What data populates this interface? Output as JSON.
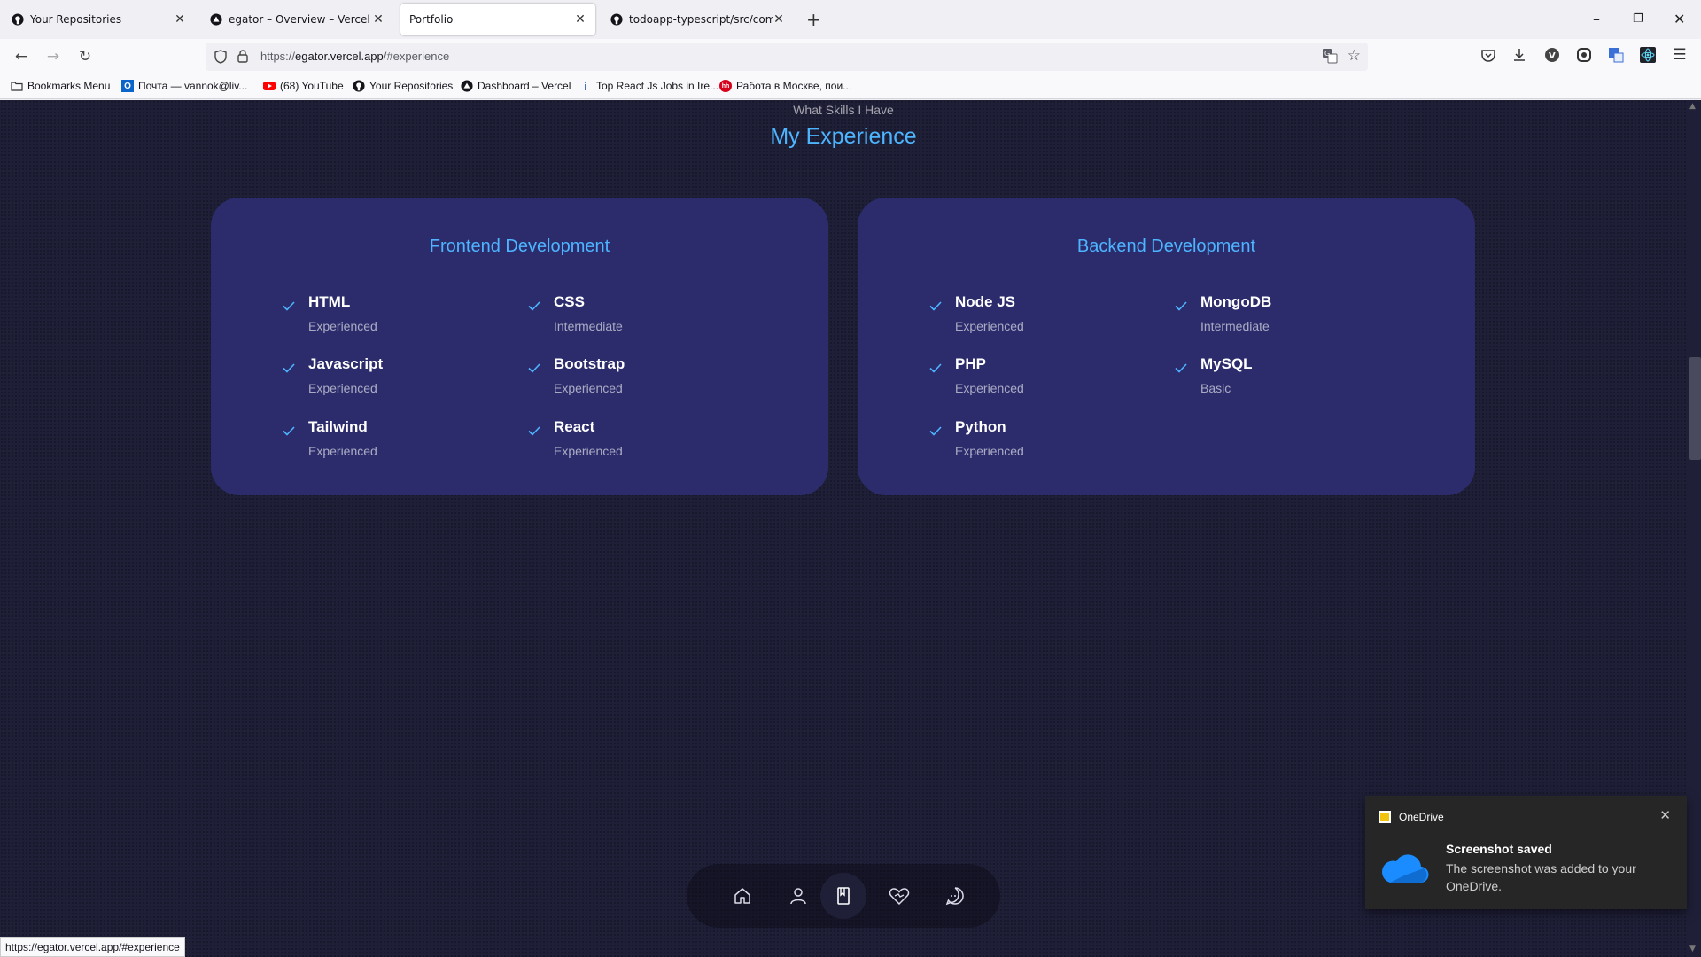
{
  "browser": {
    "tabs": [
      {
        "title": "Your Repositories",
        "icon": "github-icon",
        "active": false
      },
      {
        "title": "egator – Overview – Vercel",
        "icon": "vercel-icon",
        "active": false
      },
      {
        "title": "Portfolio",
        "icon": "",
        "active": true
      },
      {
        "title": "todoapp-typescript/src/compo",
        "icon": "github-icon",
        "active": false
      }
    ],
    "url_prefix": "https://",
    "url_domain": "egator.vercel.app",
    "url_path": "/#experience",
    "bookmarks": [
      {
        "label": "Bookmarks Menu",
        "icon": "folder-icon"
      },
      {
        "label": "Почта — vannok@liv...",
        "icon": "outlook-icon"
      },
      {
        "label": "(68) YouTube",
        "icon": "youtube-icon"
      },
      {
        "label": "Your Repositories",
        "icon": "github-icon"
      },
      {
        "label": "Dashboard – Vercel",
        "icon": "vercel-icon"
      },
      {
        "label": "Top React Js Jobs in Ire...",
        "icon": "indeed-icon"
      },
      {
        "label": "Работа в Москве, пои...",
        "icon": "hh-icon"
      }
    ]
  },
  "page": {
    "subtitle": "What Skills I Have",
    "heading": "My Experience",
    "accent_color": "#4db5ff",
    "card_color": "#2c2c6c",
    "background_color": "#1f1f38",
    "cards": [
      {
        "title": "Frontend Development",
        "skills": [
          {
            "name": "HTML",
            "level": "Experienced"
          },
          {
            "name": "CSS",
            "level": "Intermediate"
          },
          {
            "name": "Javascript",
            "level": "Experienced"
          },
          {
            "name": "Bootstrap",
            "level": "Experienced"
          },
          {
            "name": "Tailwind",
            "level": "Experienced"
          },
          {
            "name": "React",
            "level": "Experienced"
          }
        ]
      },
      {
        "title": "Backend Development",
        "skills": [
          {
            "name": "Node JS",
            "level": "Experienced"
          },
          {
            "name": "MongoDB",
            "level": "Intermediate"
          },
          {
            "name": "PHP",
            "level": "Experienced"
          },
          {
            "name": "MySQL",
            "level": "Basic"
          },
          {
            "name": "Python",
            "level": "Experienced"
          }
        ]
      }
    ],
    "dock": [
      "home-icon",
      "user-icon",
      "book-icon",
      "services-icon",
      "message-icon"
    ],
    "dock_active": "book-icon"
  },
  "status_link": "https://egator.vercel.app/#experience",
  "toast": {
    "app": "OneDrive",
    "title": "Screenshot saved",
    "body": "The screenshot was added to your OneDrive."
  }
}
